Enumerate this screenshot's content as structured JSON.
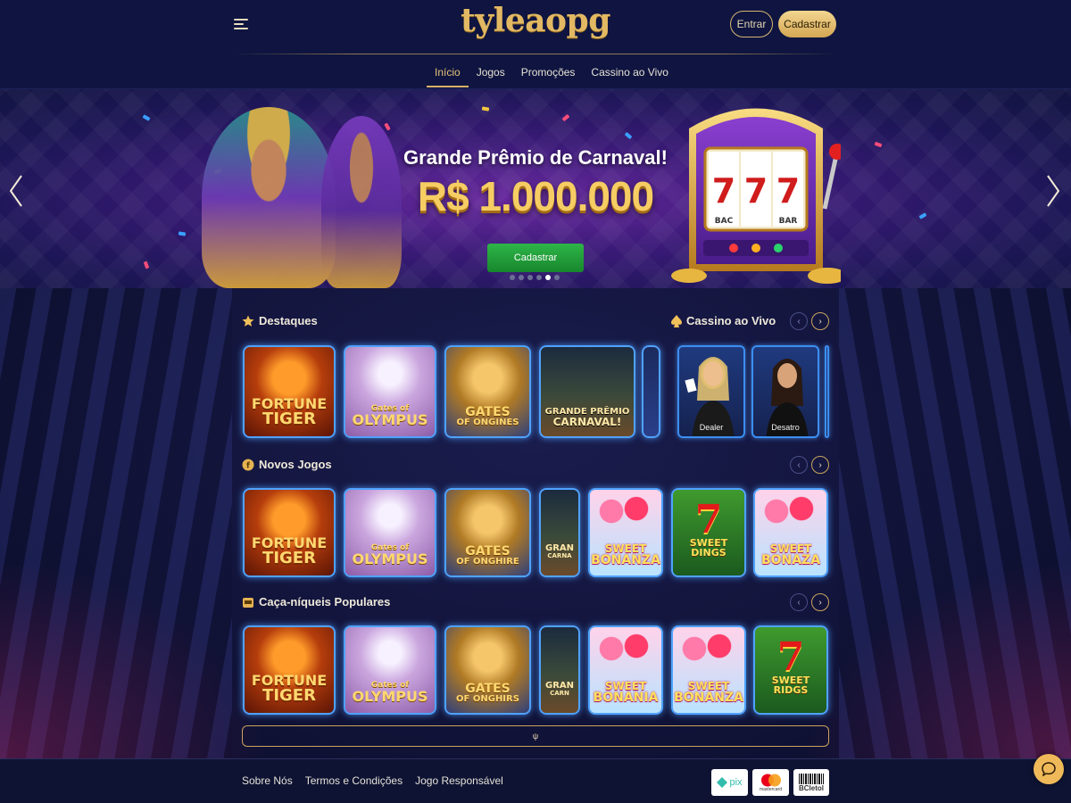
{
  "header": {
    "logo": "tyleaopg",
    "login_label": "Entrar",
    "signup_label": "Cadastrar",
    "nav": [
      {
        "label": "Início",
        "active": true
      },
      {
        "label": "Jogos",
        "active": false
      },
      {
        "label": "Promoções",
        "active": false
      },
      {
        "label": "Cassino ao Vivo",
        "active": false
      }
    ]
  },
  "banner": {
    "title": "Grande Prêmio de Carnaval!",
    "amount": "R$ 1.000.000",
    "cta_label": "Cadastrar",
    "slide_count": 6,
    "active_slide": 5,
    "slot_left": "BAC",
    "slot_right": "BAR"
  },
  "sections": {
    "destaques": {
      "title": "Destaques",
      "games": [
        {
          "line1": "FORTUNE",
          "line2": "TIGER"
        },
        {
          "line1": "Gates of",
          "line2": "OLYMPUS"
        },
        {
          "line1": "GATES",
          "line2": "OF ONGINES"
        },
        {
          "line1": "GRANDE PRÊMIO",
          "line2": "CARNAVAL!"
        }
      ]
    },
    "live": {
      "title": "Cassino ao Vivo",
      "dealers": [
        {
          "label": "Dealer"
        },
        {
          "label": "Desatro"
        }
      ]
    },
    "novos": {
      "title": "Novos Jogos",
      "games": [
        {
          "line1": "FORTUNE",
          "line2": "TIGER"
        },
        {
          "line1": "Gates of",
          "line2": "OLYMPUS"
        },
        {
          "line1": "GATES",
          "line2": "OF ONGHIRE"
        },
        {
          "line1": "GRAN",
          "line2": "CARNA"
        },
        {
          "line1": "SWEET",
          "line2": "BONANZA"
        },
        {
          "line1": "7",
          "line2": "SWEET DINGS"
        },
        {
          "line1": "SWEET",
          "line2": "BONAZA"
        }
      ]
    },
    "populares": {
      "title": "Caça-níqueis Populares",
      "games": [
        {
          "line1": "FORTUNE",
          "line2": "TIGER"
        },
        {
          "line1": "Gates of",
          "line2": "OLYMPUS"
        },
        {
          "line1": "GATES",
          "line2": "OF ONGHIRS"
        },
        {
          "line1": "GRAN",
          "line2": "CARN"
        },
        {
          "line1": "SWEET",
          "line2": "BONANIA"
        },
        {
          "line1": "SWEET",
          "line2": "BONANZA"
        },
        {
          "line1": "7",
          "line2": "SWEET RIDGS"
        }
      ]
    }
  },
  "load_more_label": "ψ",
  "footer": {
    "links": [
      "Sobre Nós",
      "Termos e Condições",
      "Jogo Responsável"
    ],
    "payments": {
      "pix": "pix",
      "mastercard": "mastercard",
      "boleto": "BCletol"
    }
  },
  "colors": {
    "gold": "#e2b863",
    "bg": "#10133a",
    "green_cta": "#2eb548",
    "tile_border": "#4fa2ff"
  }
}
